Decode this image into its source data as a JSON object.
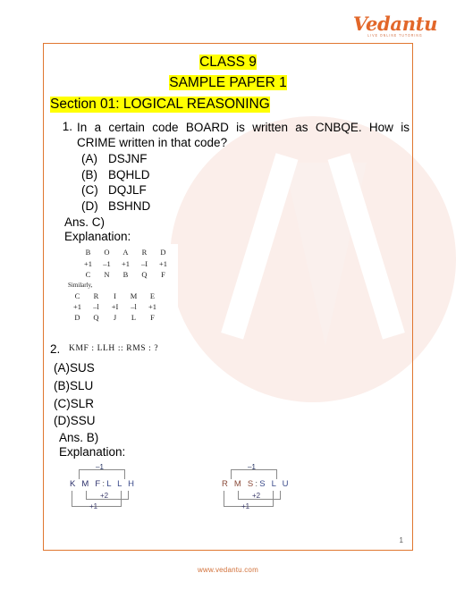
{
  "brand": {
    "logo_text": "Vedantu",
    "logo_tagline": "LIVE ONLINE TUTORING",
    "accent_color": "#e2672a",
    "border_color": "#e0762f",
    "highlight_color": "#ffff00",
    "watermark_color": "#fbeeea"
  },
  "header": {
    "class_line": "CLASS 9",
    "paper_line": "SAMPLE PAPER 1",
    "section_line": "Section 01: LOGICAL REASONING"
  },
  "questions": [
    {
      "number": "1.",
      "text": "In a certain code BOARD is written as CNBQE. How is CRIME written in that code?",
      "options": [
        {
          "key": "(A)",
          "value": "DSJNF"
        },
        {
          "key": "(B)",
          "value": "BQHLD"
        },
        {
          "key": "(C)",
          "value": "DQJLF"
        },
        {
          "key": "(D)",
          "value": "BSHND"
        }
      ],
      "answer": "Ans. C)",
      "explanation_label": "Explanation:",
      "explanation_table": {
        "row1": [
          "B",
          "O",
          "A",
          "R",
          "D"
        ],
        "row2": [
          "+1",
          "–1",
          "+1",
          "–I",
          "+1"
        ],
        "row3": [
          "C",
          "N",
          "B",
          "Q",
          "F"
        ],
        "similarly": "Similarly,",
        "row4": [
          "C",
          "R",
          "I",
          "M",
          "E"
        ],
        "row5": [
          "+1",
          "–l",
          "+I",
          "–l",
          "+1"
        ],
        "row6": [
          "D",
          "Q",
          "J",
          "L",
          "F"
        ]
      }
    },
    {
      "number": "2.",
      "stem": "KMF : LLH :: RMS : ?",
      "options": [
        {
          "key": "(A)",
          "value": "SUS"
        },
        {
          "key": "(B)",
          "value": "SLU"
        },
        {
          "key": "(C)",
          "value": "SLR"
        },
        {
          "key": "(D)",
          "value": "SSU"
        }
      ],
      "answer": "Ans. B)",
      "explanation_label": "Explanation:",
      "diagrams": [
        {
          "name": "kmf-llh-diagram",
          "left_group": "K M F",
          "separator": ":",
          "right_group": "L L H",
          "top_label": "–1",
          "mid_label": "+2",
          "bottom_label": "+1"
        },
        {
          "name": "rms-slu-diagram",
          "left_group": "R M S",
          "separator": ":",
          "right_group": "S L U",
          "top_label": "–1",
          "mid_label": "+2",
          "bottom_label": "+1"
        }
      ]
    }
  ],
  "footer": {
    "page_number": "1",
    "site": "www.vedantu.com"
  }
}
